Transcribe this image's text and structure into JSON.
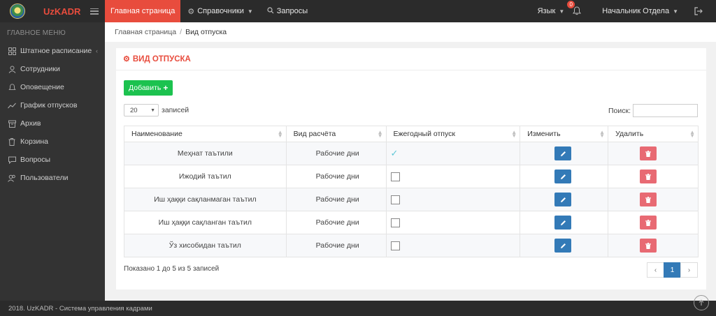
{
  "app": {
    "brand": "UzKADR",
    "logo_icon": "state-emblem-icon"
  },
  "nav": {
    "items": [
      {
        "label": "Главная страница",
        "active": true
      },
      {
        "label": "Справочники",
        "icon": "gear-icon",
        "has_caret": true
      },
      {
        "label": "Запросы",
        "icon": "search-icon"
      }
    ]
  },
  "topright": {
    "language_label": "Язык",
    "notifications_count": "0",
    "user_label": "Начальник Отдела"
  },
  "sidebar": {
    "heading": "ГЛАВНОЕ МЕНЮ",
    "items": [
      {
        "label": "Штатное расписание",
        "icon": "grid-icon"
      },
      {
        "label": "Сотрудники",
        "icon": "user-icon"
      },
      {
        "label": "Оповещение",
        "icon": "bell-icon"
      },
      {
        "label": "График отпусков",
        "icon": "trend-icon"
      },
      {
        "label": "Архив",
        "icon": "archive-icon"
      },
      {
        "label": "Корзина",
        "icon": "trash-icon"
      },
      {
        "label": "Вопросы",
        "icon": "chat-icon"
      },
      {
        "label": "Пользователи",
        "icon": "users-icon"
      }
    ]
  },
  "breadcrumb": {
    "home": "Главная страница",
    "sep": "/",
    "current": "Вид отпуска"
  },
  "panel": {
    "title": "ВИД ОТПУСКА",
    "add_label": "Добавить",
    "page_length": "20",
    "entries_label": "записей",
    "search_label": "Поиск:",
    "search_value": ""
  },
  "table": {
    "columns": [
      "Наименование",
      "Вид расчёта",
      "Ежегодный отпуск",
      "Изменить",
      "Удалить"
    ],
    "rows": [
      {
        "name": "Меҳнат таътили",
        "calc": "Рабочие дни",
        "annual": true
      },
      {
        "name": "Ижодий таътил",
        "calc": "Рабочие дни",
        "annual": false
      },
      {
        "name": "Иш ҳаққи сақланмаган таътил",
        "calc": "Рабочие дни",
        "annual": false
      },
      {
        "name": "Иш ҳаққи сақланган таътил",
        "calc": "Рабочие дни",
        "annual": false
      },
      {
        "name": "Ўз хисобидан таътил",
        "calc": "Рабочие дни",
        "annual": false
      }
    ]
  },
  "pagination": {
    "info": "Показано 1 до 5 из 5 записей",
    "prev": "‹",
    "current": "1",
    "next": "›"
  },
  "footer": {
    "text": "2018. UzKADR - Система управления кадрами"
  },
  "colors": {
    "accent": "#e84c3d",
    "topbar": "#2b2b2b",
    "sidebar": "#333333",
    "add": "#1cc24f",
    "edit": "#337ab7",
    "delete": "#e86a73"
  }
}
